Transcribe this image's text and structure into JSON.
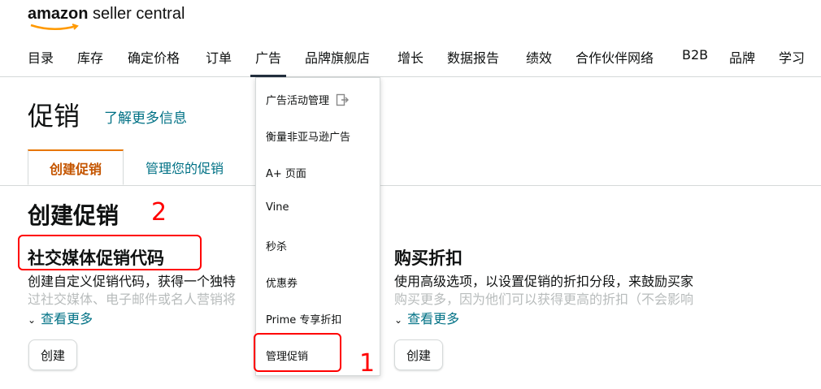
{
  "header": {
    "logo_brand": "amazon",
    "logo_rest": " seller central"
  },
  "nav": [
    "目录",
    "库存",
    "确定价格",
    "订单",
    "广告",
    "品牌旗舰店",
    "增长",
    "数据报告",
    "绩效",
    "合作伙伴网络",
    "B2B",
    "品牌",
    "学习"
  ],
  "page": {
    "title": "促销",
    "learn_more": "了解更多信息"
  },
  "tabs": {
    "create": "创建促销",
    "manage": "管理您的促销"
  },
  "section": {
    "title": "创建促销"
  },
  "cards": [
    {
      "title": "社交媒体促销代码",
      "desc_line1": "创建自定义促销代码，获得一个独特",
      "desc_line2": "过社交媒体、电子邮件或名人营销将",
      "see_more": "查看更多",
      "button": "创建"
    },
    {
      "title": "购买折扣",
      "desc_line1": "使用高级选项，以设置促销的折扣分段，来鼓励买家",
      "desc_line2": "购买更多，因为他们可以获得更高的折扣（不会影响",
      "see_more": "查看更多",
      "button": "创建"
    }
  ],
  "dropdown": [
    "广告活动管理",
    "衡量非亚马逊广告",
    "A+ 页面",
    "Vine",
    "秒杀",
    "优惠券",
    "Prime 专享折扣",
    "管理促销"
  ],
  "annotations": {
    "one": "1",
    "two": "2"
  },
  "colors": {
    "accent_orange": "#e77600",
    "link_teal": "#007185",
    "annotation_red": "#ff0000"
  }
}
